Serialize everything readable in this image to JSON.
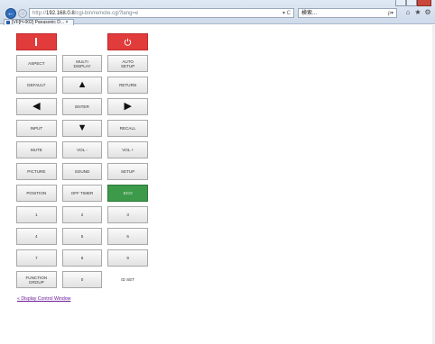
{
  "browser": {
    "url_prefix": "http://",
    "url_host": "192.168.0.8",
    "url_path": "/cgi-bin/remote.cgi?lang=e",
    "address_icons": "▾ C",
    "search_text": "検索...",
    "search_icon": "ρ▾",
    "toolbar_icons": [
      "⌂",
      "★",
      "⚙"
    ],
    "tab_title": "[VF[H-002] Panasonic D... ×",
    "back_glyph": "←",
    "forward_glyph": "→"
  },
  "remote": {
    "rows": [
      [
        {
          "label": "",
          "kind": "power-off"
        },
        {
          "label": "",
          "kind": "empty"
        },
        {
          "label": "",
          "kind": "power-on"
        }
      ],
      [
        {
          "label": "ASPECT"
        },
        {
          "label": "MULTI\nDISPLAY"
        },
        {
          "label": "AUTO\nSETUP"
        }
      ],
      [
        {
          "label": "DEFAULT"
        },
        {
          "label": "▲",
          "kind": "arrow"
        },
        {
          "label": "RETURN"
        }
      ],
      [
        {
          "label": "◀",
          "kind": "arrow"
        },
        {
          "label": "ENTER"
        },
        {
          "label": "▶",
          "kind": "arrow"
        }
      ],
      [
        {
          "label": "INPUT"
        },
        {
          "label": "▼",
          "kind": "arrow"
        },
        {
          "label": "RECALL"
        }
      ],
      [
        {
          "label": "MUTE"
        },
        {
          "label": "VOL -"
        },
        {
          "label": "VOL +"
        }
      ],
      [
        {
          "label": "PICTURE"
        },
        {
          "label": "SOUND"
        },
        {
          "label": "SETUP"
        }
      ],
      [
        {
          "label": "POSITION"
        },
        {
          "label": "OFF TIMER"
        },
        {
          "label": "ECO",
          "kind": "green"
        }
      ],
      [
        {
          "label": "1"
        },
        {
          "label": "2"
        },
        {
          "label": "3"
        }
      ],
      [
        {
          "label": "4"
        },
        {
          "label": "5"
        },
        {
          "label": "6"
        }
      ],
      [
        {
          "label": "7"
        },
        {
          "label": "8"
        },
        {
          "label": "9"
        }
      ],
      [
        {
          "label": "FUNCTION\nGROUP"
        },
        {
          "label": "0"
        },
        {
          "label": "ID SET",
          "kind": "text"
        }
      ]
    ]
  },
  "link": {
    "display_control": "« Display Control Window"
  },
  "colors": {
    "power": "#e23b3b",
    "eco": "#3c9a4a",
    "link": "#6a1b9a"
  }
}
